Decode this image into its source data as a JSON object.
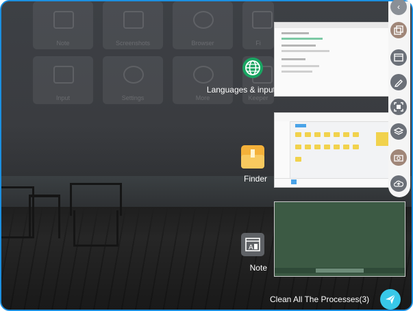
{
  "background_tiles": [
    {
      "label": "Note",
      "icon": "note-icon"
    },
    {
      "label": "Screenshots",
      "icon": "screenshot-icon"
    },
    {
      "label": "Browser",
      "icon": "globe-icon"
    },
    {
      "label": "Fi",
      "icon": "folder-icon"
    },
    {
      "label": "Input",
      "icon": "input-icon"
    },
    {
      "label": "Settings",
      "icon": "gear-icon"
    },
    {
      "label": "More",
      "icon": "more-icon"
    },
    {
      "label": "Keeper",
      "icon": "keeper-icon"
    }
  ],
  "recent_apps": [
    {
      "label": "Languages & input",
      "icon": "globe-icon",
      "color": "#1aa462"
    },
    {
      "label": "Finder",
      "icon": "folder-icon",
      "color": "#f4b13a"
    },
    {
      "label": "Note",
      "icon": "note-icon",
      "color": "#5f6266"
    }
  ],
  "side_toolbar": [
    {
      "icon": "back-icon",
      "color": "#8a8f96"
    },
    {
      "icon": "windows-icon",
      "color": "#a08678"
    },
    {
      "icon": "whiteboard-icon",
      "color": "#6b7078"
    },
    {
      "icon": "pen-icon",
      "color": "#6b7078"
    },
    {
      "icon": "scan-icon",
      "color": "#6b7078"
    },
    {
      "icon": "layers-icon",
      "color": "#6b7078"
    },
    {
      "icon": "camera-icon",
      "color": "#a08678"
    },
    {
      "icon": "upload-icon",
      "color": "#6b7078"
    }
  ],
  "clean_button": {
    "label": "Clean All The Processes(3)",
    "color": "#38c8e8"
  },
  "frame_color": "#1b8fe0"
}
